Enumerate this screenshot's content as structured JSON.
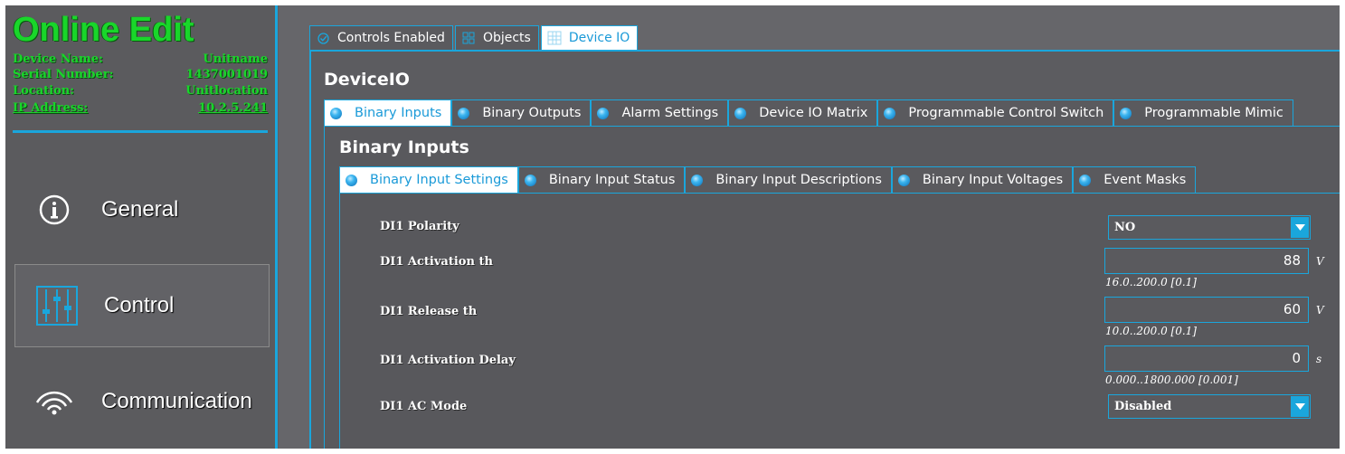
{
  "left_panel": {
    "app_title": "Online Edit",
    "device_info": [
      {
        "label": "Device Name:",
        "value": "Unitname"
      },
      {
        "label": "Serial Number:",
        "value": "1437001019"
      },
      {
        "label": "Location:",
        "value": "Unitlocation"
      },
      {
        "label": "IP Address:",
        "value": "10.2.5.241"
      }
    ],
    "nav_items": [
      {
        "label": "General",
        "icon": "info-icon",
        "selected": false
      },
      {
        "label": "Control",
        "icon": "sliders-icon",
        "selected": true
      },
      {
        "label": "Communication",
        "icon": "signal-icon",
        "selected": false
      }
    ]
  },
  "top_tabs": [
    {
      "label": "Controls Enabled",
      "icon": "check-icon",
      "active": false
    },
    {
      "label": "Objects",
      "icon": "objects-icon",
      "active": false
    },
    {
      "label": "Device IO",
      "icon": "device-io-icon",
      "active": true
    }
  ],
  "device_io": {
    "title": "DeviceIO",
    "tabs": [
      {
        "label": "Binary Inputs",
        "active": true
      },
      {
        "label": "Binary Outputs",
        "active": false
      },
      {
        "label": "Alarm Settings",
        "active": false
      },
      {
        "label": "Device IO Matrix",
        "active": false
      },
      {
        "label": "Programmable Control Switch",
        "active": false
      },
      {
        "label": "Programmable Mimic",
        "active": false
      }
    ]
  },
  "binary_inputs": {
    "title": "Binary Inputs",
    "tabs": [
      {
        "label": "Binary Input Settings",
        "active": true
      },
      {
        "label": "Binary Input Status",
        "active": false
      },
      {
        "label": "Binary Input Descriptions",
        "active": false
      },
      {
        "label": "Binary Input Voltages",
        "active": false
      },
      {
        "label": "Event Masks",
        "active": false
      }
    ]
  },
  "settings": {
    "di1_polarity": {
      "label": "DI1 Polarity",
      "value": "NO"
    },
    "di1_activation_th": {
      "label": "DI1 Activation th",
      "value": "88",
      "unit": "V",
      "range": "16.0..200.0 [0.1]"
    },
    "di1_release_th": {
      "label": "DI1 Release th",
      "value": "60",
      "unit": "V",
      "range": "10.0..200.0 [0.1]"
    },
    "di1_activation_delay": {
      "label": "DI1 Activation Delay",
      "value": "0",
      "unit": "s",
      "range": "0.000..1800.000 [0.001]"
    },
    "di1_ac_mode": {
      "label": "DI1 AC Mode",
      "value": "Disabled"
    }
  },
  "colors": {
    "accent": "#1aa6dc",
    "status_green": "#19d62a",
    "background": "#5f5f62"
  }
}
